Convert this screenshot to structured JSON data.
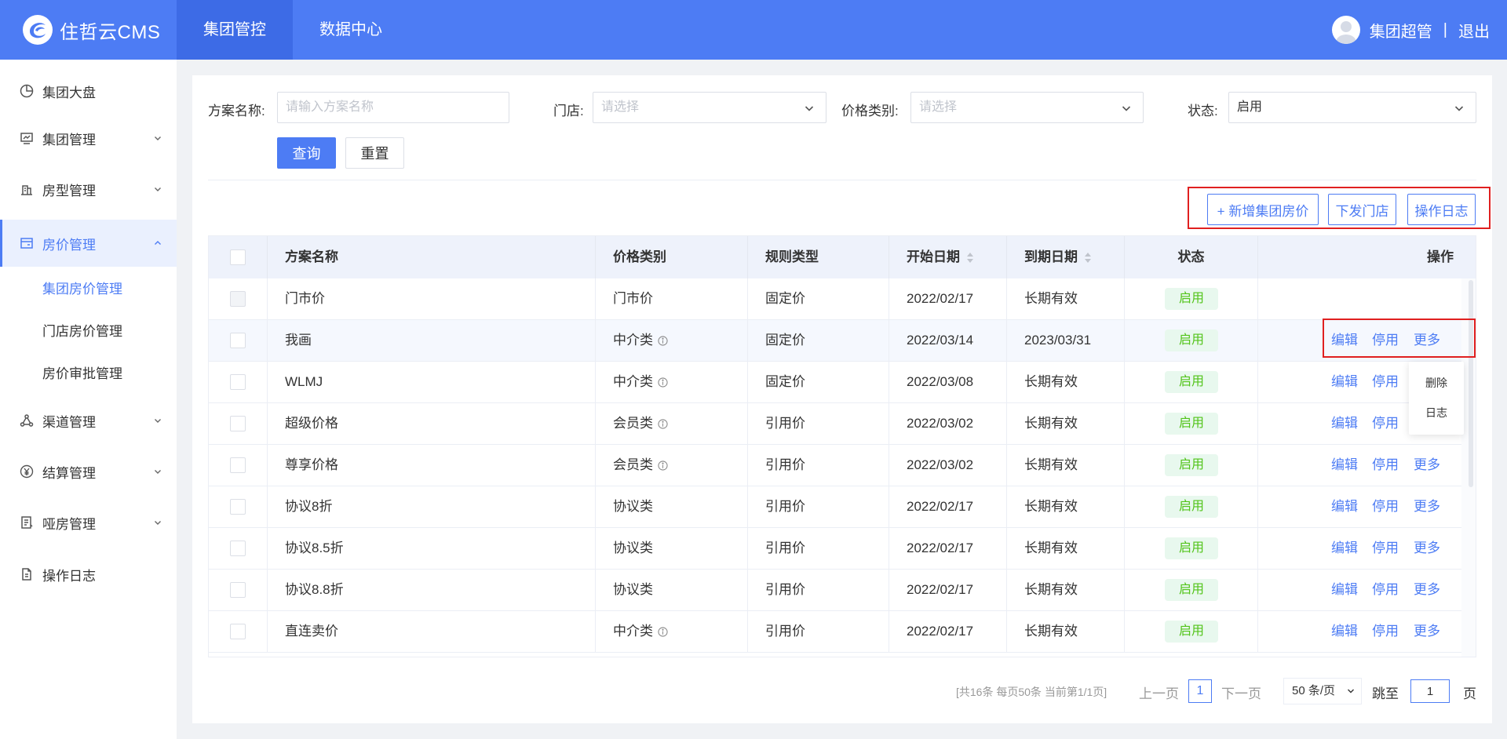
{
  "brand": {
    "name": "住哲云CMS"
  },
  "topnav": {
    "items": [
      "集团管控",
      "数据中心"
    ],
    "active": 0
  },
  "user": {
    "name": "集团超管",
    "separator": "|",
    "logout": "退出"
  },
  "sidebar": {
    "items": [
      {
        "label": "集团大盘",
        "icon": "dashboard-icon"
      },
      {
        "label": "集团管理",
        "icon": "monitor-icon"
      },
      {
        "label": "房型管理",
        "icon": "building-icon"
      },
      {
        "label": "房价管理",
        "icon": "price-card-icon"
      },
      {
        "label": "渠道管理",
        "icon": "channel-icon"
      },
      {
        "label": "结算管理",
        "icon": "yen-icon"
      },
      {
        "label": "哑房管理",
        "icon": "document-list-icon"
      },
      {
        "label": "操作日志",
        "icon": "log-file-icon"
      }
    ],
    "subitems": [
      "集团房价管理",
      "门店房价管理",
      "房价审批管理"
    ]
  },
  "filters": {
    "name_label": "方案名称:",
    "name_placeholder": "请输入方案名称",
    "store_label": "门店:",
    "store_placeholder": "请选择",
    "price_type_label": "价格类别:",
    "price_type_placeholder": "请选择",
    "status_label": "状态:",
    "status_value": "启用",
    "query": "查询",
    "reset": "重置"
  },
  "actions": {
    "add": "+ 新增集团房价",
    "dispatch": "下发门店",
    "log": "操作日志"
  },
  "table": {
    "headers": [
      "方案名称",
      "价格类别",
      "规则类型",
      "开始日期",
      "到期日期",
      "状态",
      "操作"
    ],
    "rows": [
      {
        "name": "门市价",
        "category": "门市价",
        "rule": "固定价",
        "start": "2022/02/17",
        "end": "长期有效",
        "status": "启用"
      },
      {
        "name": "我画",
        "category": "中介类",
        "rule": "固定价",
        "start": "2022/03/14",
        "end": "2023/03/31",
        "status": "启用"
      },
      {
        "name": "WLMJ",
        "category": "中介类",
        "rule": "固定价",
        "start": "2022/03/08",
        "end": "长期有效",
        "status": "启用"
      },
      {
        "name": "超级价格",
        "category": "会员类",
        "rule": "引用价",
        "start": "2022/03/02",
        "end": "长期有效",
        "status": "启用"
      },
      {
        "name": "尊享价格",
        "category": "会员类",
        "rule": "引用价",
        "start": "2022/03/02",
        "end": "长期有效",
        "status": "启用"
      },
      {
        "name": "协议8折",
        "category": "协议类",
        "rule": "引用价",
        "start": "2022/02/17",
        "end": "长期有效",
        "status": "启用"
      },
      {
        "name": "协议8.5折",
        "category": "协议类",
        "rule": "引用价",
        "start": "2022/02/17",
        "end": "长期有效",
        "status": "启用"
      },
      {
        "name": "协议8.8折",
        "category": "协议类",
        "rule": "引用价",
        "start": "2022/02/17",
        "end": "长期有效",
        "status": "启用"
      },
      {
        "name": "直连卖价",
        "category": "中介类",
        "rule": "引用价",
        "start": "2022/02/17",
        "end": "长期有效",
        "status": "启用"
      }
    ],
    "ops": {
      "edit": "编辑",
      "disable": "停用",
      "more": "更多"
    }
  },
  "dropdown": {
    "items": [
      "删除",
      "日志"
    ]
  },
  "pagination": {
    "summary": "[共16条 每页50条 当前第1/1页]",
    "prev": "上一页",
    "current": "1",
    "next": "下一页",
    "page_size": "50 条/页",
    "goto": "跳至",
    "goto_value": "1",
    "page_unit": "页"
  },
  "colors": {
    "primary": "#4d7cf4",
    "header_active": "#3d6be6",
    "success": "#52c41a",
    "highlight": "#e02020"
  }
}
